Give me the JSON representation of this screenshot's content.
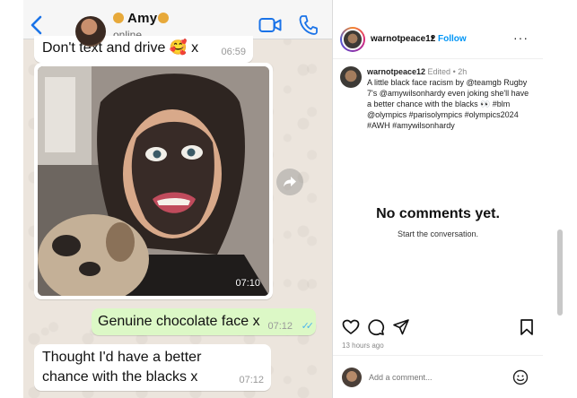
{
  "whatsapp": {
    "contact_name": "Amy",
    "status": "online",
    "messages": [
      {
        "direction": "incoming",
        "text": "Don't text and drive 🥰 x",
        "time": "06:59"
      },
      {
        "direction": "incoming",
        "type": "photo",
        "time": "07:10"
      },
      {
        "direction": "outgoing",
        "text": "Genuine chocolate face x",
        "time": "07:12",
        "read_ticks": "✓✓"
      },
      {
        "direction": "incoming",
        "text": "Thought I'd have a better chance with the blacks x",
        "time": "07:12"
      }
    ],
    "colors": {
      "incoming": "#ffffff",
      "outgoing": "#dcf8c6",
      "accent": "#1a73e8",
      "read_tick": "#4fb6ec"
    }
  },
  "instagram": {
    "username": "warnotpeace12",
    "separator": "•",
    "follow_label": "Follow",
    "more_label": "···",
    "caption": {
      "username": "warnotpeace12",
      "meta": "Edited • 2h",
      "text": "A little black face racism by @teamgb Rugby 7's @amywilsonhardy even joking she'll have a better chance with the blacks 👀 #blm @olympics #parisolympics #olympics2024 #AWH #amywilsonhardy"
    },
    "no_comments_title": "No comments yet.",
    "no_comments_sub": "Start the conversation.",
    "time_ago": "13 hours ago",
    "comment_placeholder": "Add a comment...",
    "colors": {
      "follow": "#0095f6"
    }
  }
}
